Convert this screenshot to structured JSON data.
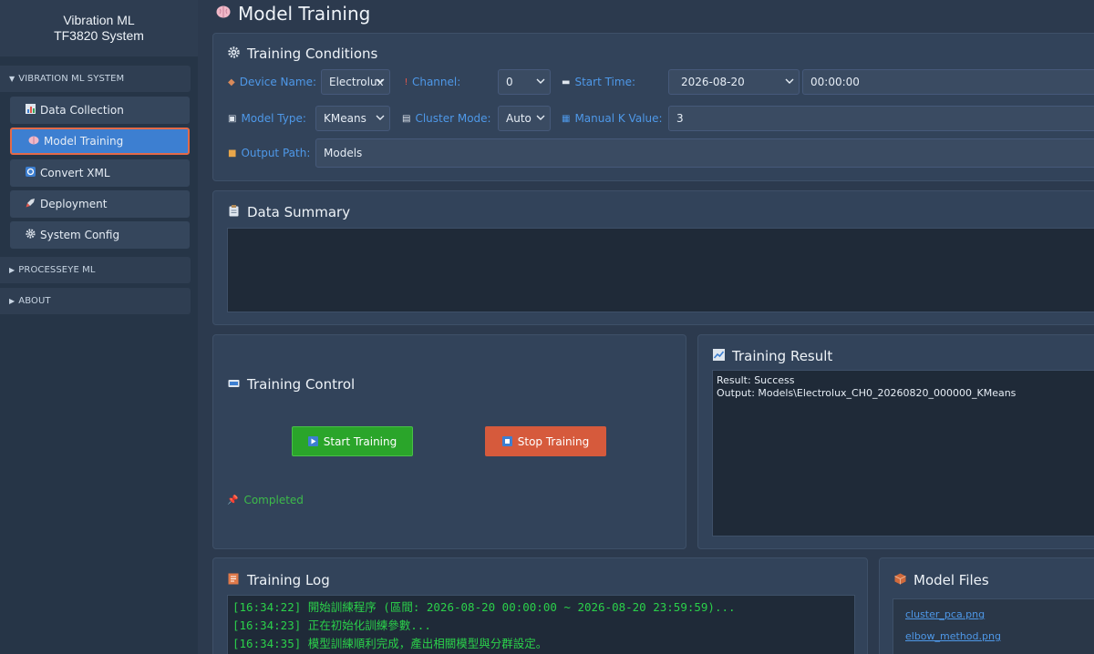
{
  "app": {
    "title_line1": "Vibration ML",
    "title_line2": "TF3820 System"
  },
  "sidebar": {
    "groups": {
      "vibration": {
        "label": "VIBRATION ML SYSTEM",
        "expanded": true
      },
      "processeye": {
        "label": "PROCESSEYE ML",
        "expanded": false
      },
      "about": {
        "label": "ABOUT",
        "expanded": false
      }
    },
    "items": [
      {
        "label": "Data Collection",
        "icon": "chart-icon"
      },
      {
        "label": "Model Training",
        "icon": "brain-icon",
        "active": true
      },
      {
        "label": "Convert XML",
        "icon": "convert-icon"
      },
      {
        "label": "Deployment",
        "icon": "rocket-icon"
      },
      {
        "label": "System Config",
        "icon": "gear-icon"
      }
    ]
  },
  "page": {
    "title": "Model Training",
    "icon": "brain-icon"
  },
  "conditions": {
    "title": "Training Conditions",
    "device_label": "Device Name:",
    "device_value": "Electrolux",
    "channel_label": "Channel:",
    "channel_value": "0",
    "start_label": "Start Time:",
    "start_date": "2026-08-20",
    "start_time": "00:00:00",
    "model_label": "Model Type:",
    "model_value": "KMeans",
    "cluster_label": "Cluster Mode:",
    "cluster_value": "Auto",
    "k_label": "Manual K Value:",
    "k_value": "3",
    "output_label": "Output Path:",
    "output_value": "Models"
  },
  "summary": {
    "title": "Data Summary"
  },
  "control": {
    "title": "Training Control",
    "start_label": "Start Training",
    "stop_label": "Stop Training",
    "status": "Completed"
  },
  "result": {
    "title": "Training Result",
    "line1": "Result: Success",
    "line2": "Output: Models\\Electrolux_CH0_20260820_000000_KMeans"
  },
  "log": {
    "title": "Training Log",
    "lines": [
      "[16:34:22] 開始訓練程序 (區間: 2026-08-20 00:00:00 ~ 2026-08-20 23:59:59)...",
      "[16:34:23] 正在初始化訓練參數...",
      "[16:34:35] 模型訓練順利完成，產出相關模型與分群設定。"
    ]
  },
  "files": {
    "title": "Model Files",
    "items": [
      "cluster_pca.png",
      "elbow_method.png"
    ]
  },
  "colors": {
    "accent": "#3d7fd1",
    "label_blue": "#4e98e8",
    "start_green": "#2aa52a",
    "stop_red": "#d65a3c",
    "log_green": "#2bd04a",
    "status_green": "#3dbb4a"
  }
}
